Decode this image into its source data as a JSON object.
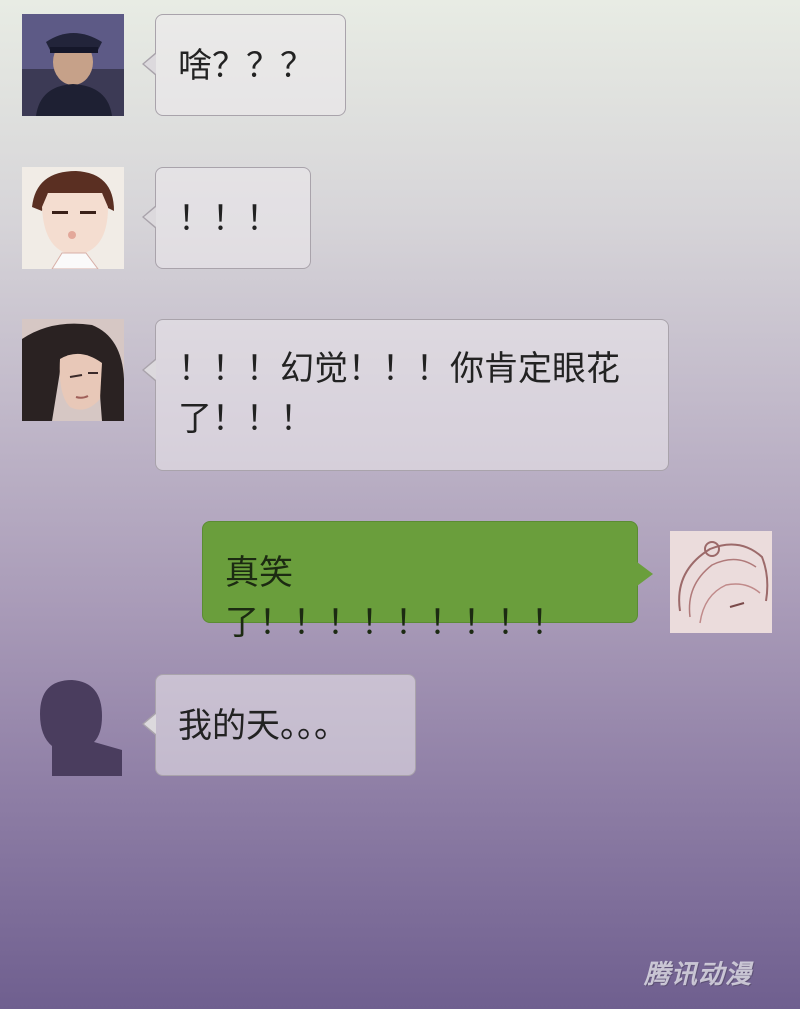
{
  "messages": [
    {
      "sender": "officer",
      "side": "left",
      "text": "啥？？？",
      "avatar_icon": "officer-cap-avatar"
    },
    {
      "sender": "boy",
      "side": "left",
      "text": "！！！",
      "avatar_icon": "chibi-boy-avatar"
    },
    {
      "sender": "long-haired",
      "side": "left",
      "text": "！！！幻觉！！！你肯定眼花\n了！！！",
      "avatar_icon": "long-hair-avatar"
    },
    {
      "sender": "self",
      "side": "right",
      "text": "真笑了！！！！！！！！！",
      "avatar_icon": "sketch-girl-avatar"
    },
    {
      "sender": "silhouette",
      "side": "left",
      "text": "我的天。。。",
      "avatar_icon": "silhouette-avatar"
    }
  ],
  "watermark": "腾讯动漫",
  "colors": {
    "bubble_border": "#a9a3ab",
    "bubble_green": "#6a9e3c",
    "background_top": "#e8ece4",
    "background_bottom": "#6f5f8f"
  }
}
